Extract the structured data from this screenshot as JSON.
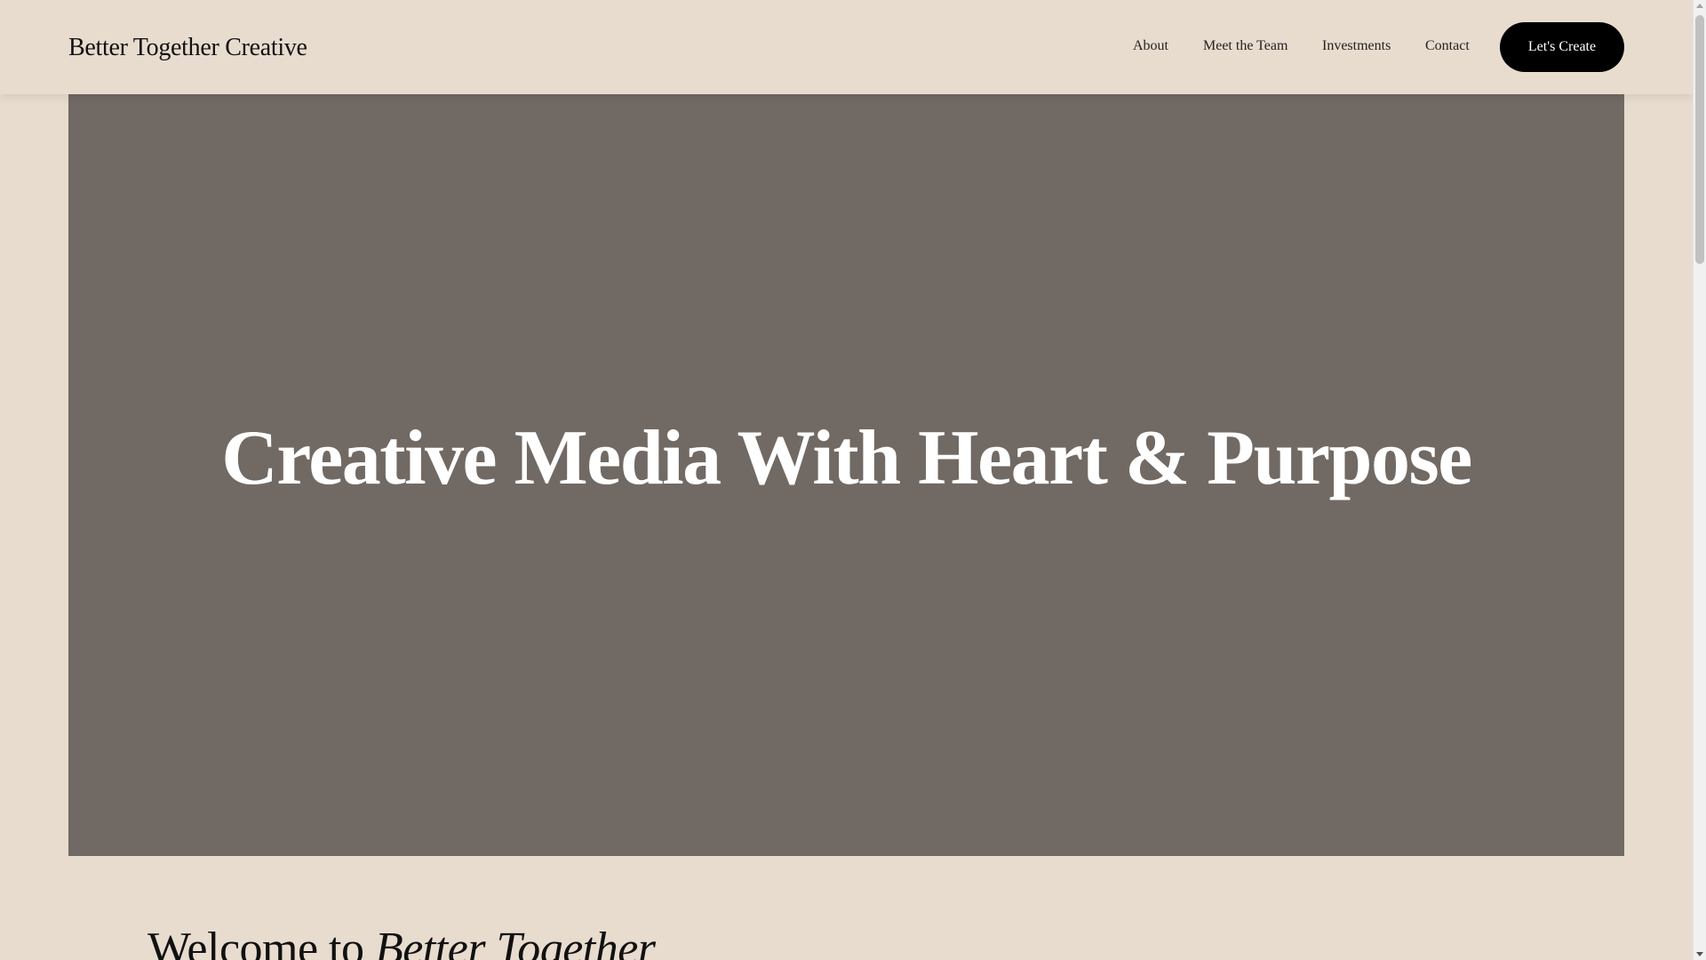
{
  "header": {
    "logo": "Better Together Creative",
    "nav": {
      "about": "About",
      "team": "Meet the Team",
      "investments": "Investments",
      "contact": "Contact"
    },
    "cta_label": "Let's Create"
  },
  "hero": {
    "title": "Creative Media With Heart & Purpose",
    "background_color": "#716963"
  },
  "welcome": {
    "prefix": "Welcome to ",
    "emphasis": "Better Together"
  },
  "colors": {
    "page_background": "#e8dccf",
    "cta_background": "#000000",
    "text": "#111111"
  },
  "icons": {
    "scroll_up": "chevron-up-icon",
    "scroll_down": "chevron-down-icon"
  }
}
